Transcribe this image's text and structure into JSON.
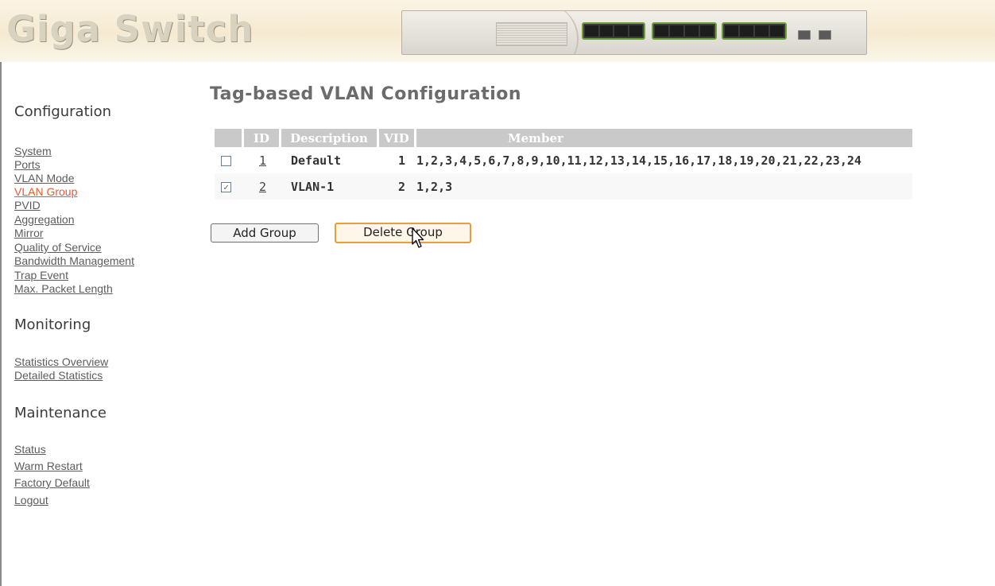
{
  "header": {
    "logo_text": "Giga Switch"
  },
  "sidebar": {
    "sections": [
      {
        "title": "Configuration"
      },
      {
        "title": "Monitoring"
      },
      {
        "title": "Maintenance"
      }
    ],
    "configuration_links": [
      "System",
      "Ports",
      "VLAN Mode",
      "VLAN Group",
      "PVID",
      "Aggregation",
      "Mirror",
      "Quality of Service",
      "Bandwidth Management",
      "Trap Event",
      "Max. Packet Length"
    ],
    "monitoring_links": [
      "Statistics Overview",
      "Detailed Statistics"
    ],
    "maintenance_links": [
      "Status",
      "Warm Restart",
      "Factory Default",
      "Logout"
    ],
    "active_link": "VLAN Group",
    "active_color": "#e85a2a"
  },
  "main": {
    "title": "Tag-based VLAN Configuration",
    "table": {
      "headers": [
        "",
        "ID",
        "Description",
        "VID",
        "Member"
      ],
      "rows": [
        {
          "checked": false,
          "id": "1",
          "description": "Default",
          "vid": "1",
          "member": "1,2,3,4,5,6,7,8,9,10,11,12,13,14,15,16,17,18,19,20,21,22,23,24"
        },
        {
          "checked": true,
          "id": "2",
          "description": "VLAN-1",
          "vid": "2",
          "member": "1,2,3"
        }
      ]
    },
    "buttons": {
      "add": "Add Group",
      "delete": "Delete Group"
    }
  }
}
